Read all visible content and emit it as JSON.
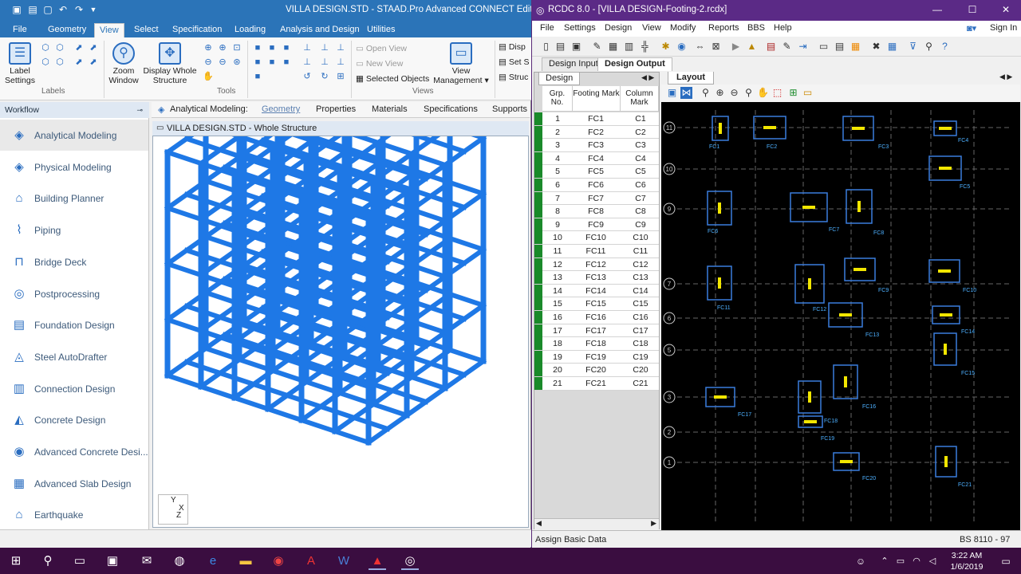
{
  "staad": {
    "title": "VILLA DESIGN.STD - STAAD.Pro Advanced CONNECT Edition",
    "tabs": [
      "File",
      "Geometry",
      "View",
      "Select",
      "Specification",
      "Loading",
      "Analysis and Design",
      "Utilities"
    ],
    "ribbon": {
      "label_settings": "Label Settings",
      "group_labels": "Labels",
      "zoom_window": "Zoom Window",
      "display_whole": "Display Whole Structure",
      "group_tools": "Tools",
      "open_view": "Open View",
      "new_view": "New View",
      "selected_objects": "Selected Objects",
      "view_management": "View Management",
      "group_views": "Views",
      "disp": "Disp",
      "set_s": "Set S",
      "struc": "Struc"
    },
    "workflow": {
      "header": "Workflow",
      "items": [
        "Analytical Modeling",
        "Physical Modeling",
        "Building Planner",
        "Piping",
        "Bridge Deck",
        "Postprocessing",
        "Foundation Design",
        "Steel AutoDrafter",
        "Connection Design",
        "Concrete Design",
        "Advanced Concrete Desi...",
        "Advanced Slab Design",
        "Earthquake"
      ]
    },
    "model_tabs": {
      "label": "Analytical Modeling:",
      "items": [
        "Geometry",
        "Properties",
        "Materials",
        "Specifications",
        "Supports"
      ]
    },
    "viewport_title": "VILLA DESIGN.STD - Whole Structure",
    "axis": {
      "y": "Y",
      "x": "X",
      "z": "Z"
    }
  },
  "rcdc": {
    "title": "RCDC 8.0 - [VILLA DESIGN-Footing-2.rcdx]",
    "menu": [
      "File",
      "Settings",
      "Design",
      "View",
      "Modify",
      "Reports",
      "BBS",
      "Help"
    ],
    "sign_in": "Sign In",
    "doc_tabs": [
      "Design Input",
      "Design Output"
    ],
    "left_tab": "Design",
    "right_tab": "Layout",
    "table_headers": [
      "Grp. No.",
      "Footing Mark",
      "Column Mark"
    ],
    "rows": [
      [
        "1",
        "FC1",
        "C1"
      ],
      [
        "2",
        "FC2",
        "C2"
      ],
      [
        "3",
        "FC3",
        "C3"
      ],
      [
        "4",
        "FC4",
        "C4"
      ],
      [
        "5",
        "FC5",
        "C5"
      ],
      [
        "6",
        "FC6",
        "C6"
      ],
      [
        "7",
        "FC7",
        "C7"
      ],
      [
        "8",
        "FC8",
        "C8"
      ],
      [
        "9",
        "FC9",
        "C9"
      ],
      [
        "10",
        "FC10",
        "C10"
      ],
      [
        "11",
        "FC11",
        "C11"
      ],
      [
        "12",
        "FC12",
        "C12"
      ],
      [
        "13",
        "FC13",
        "C13"
      ],
      [
        "14",
        "FC14",
        "C14"
      ],
      [
        "15",
        "FC15",
        "C15"
      ],
      [
        "16",
        "FC16",
        "C16"
      ],
      [
        "17",
        "FC17",
        "C17"
      ],
      [
        "18",
        "FC18",
        "C18"
      ],
      [
        "19",
        "FC19",
        "C19"
      ],
      [
        "20",
        "FC20",
        "C20"
      ],
      [
        "21",
        "FC21",
        "C21"
      ]
    ],
    "grid_labels": [
      "11",
      "10",
      "9",
      "7",
      "6",
      "5",
      "3",
      "2",
      "1"
    ],
    "footings": [
      "FC1",
      "FC2",
      "FC3",
      "FC4",
      "FC5",
      "FC6",
      "FC7",
      "FC8",
      "FC9",
      "FC10",
      "FC11",
      "FC12",
      "FC13",
      "FC14",
      "FC15",
      "FC16",
      "FC17",
      "FC18",
      "FC19",
      "FC20",
      "FC21"
    ],
    "status_left": "Assign Basic Data",
    "status_right": "BS 8110 - 97"
  },
  "taskbar": {
    "time": "3:22 AM",
    "date": "1/6/2019"
  },
  "colors": {
    "staad_blue": "#2b74b8",
    "rcdc_purple": "#5b2a86",
    "frame_blue": "#1e78e6",
    "footing_yellow": "#f2e600",
    "grid_green": "#1a8a2a"
  }
}
